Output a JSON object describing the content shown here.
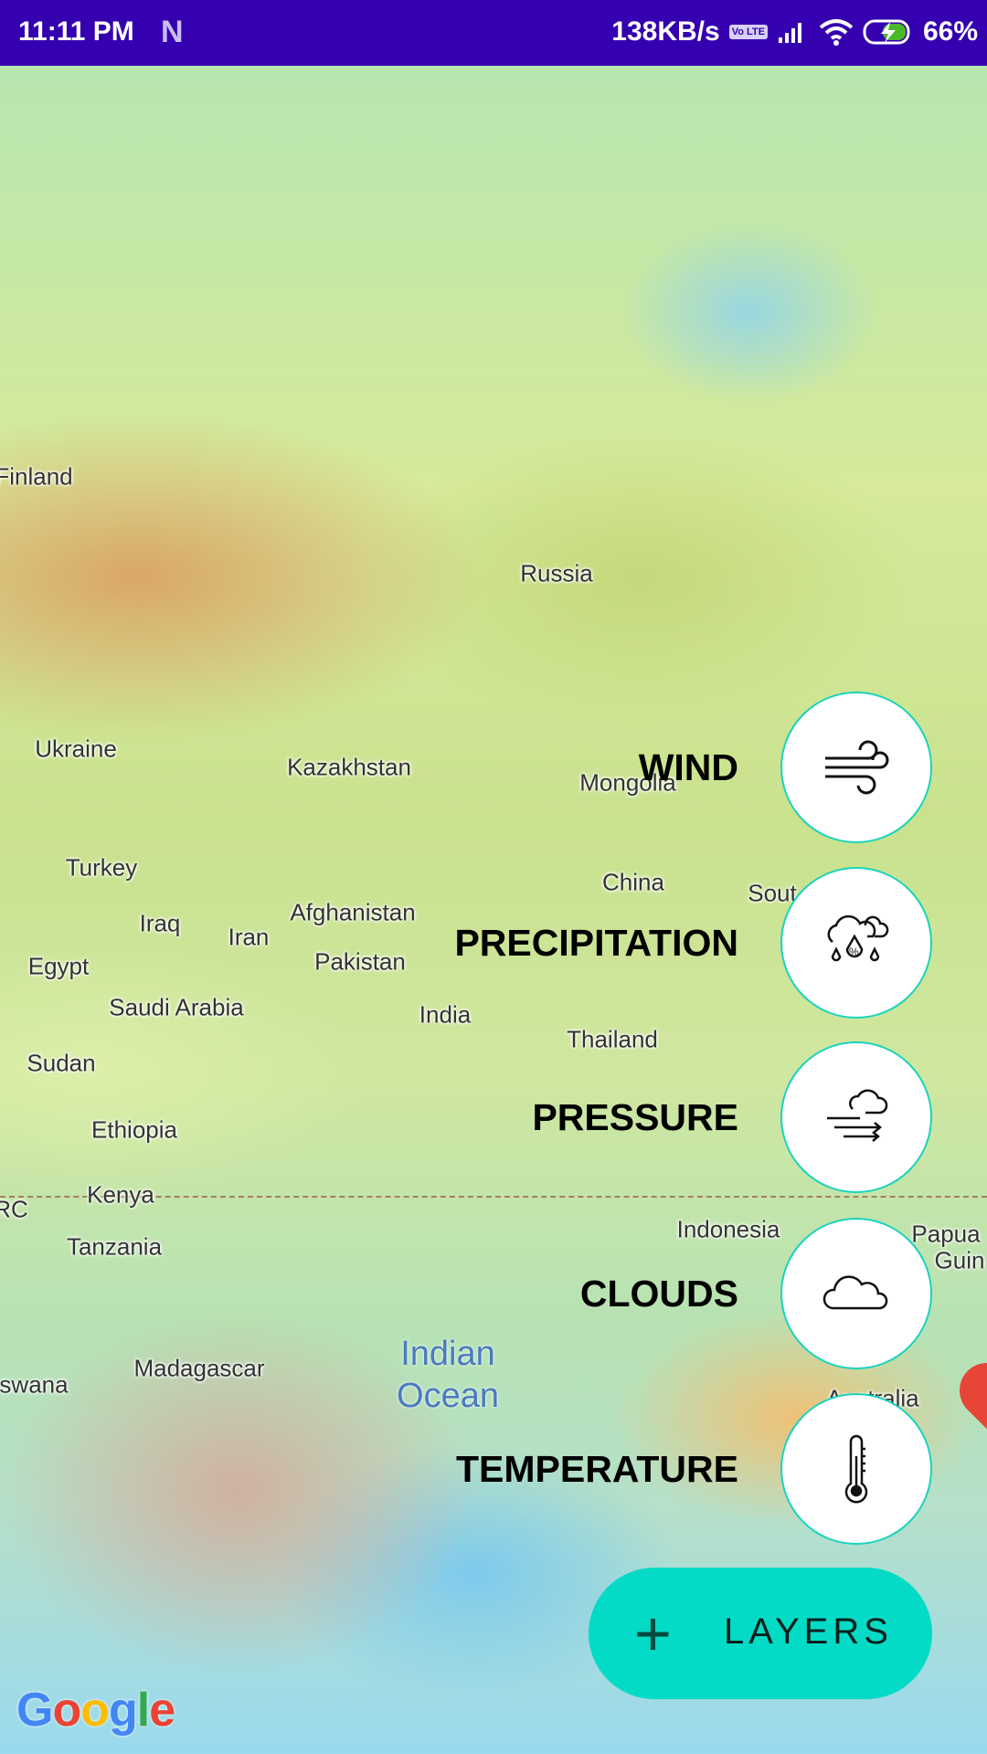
{
  "status_bar": {
    "time": "11:11 PM",
    "notification_icon": "N",
    "speed": "138KB/s",
    "volte": "Vo LTE",
    "battery": "66%"
  },
  "map": {
    "labels": [
      "Finland",
      "Russia",
      "Ukraine",
      "Kazakhstan",
      "Mongolia",
      "Turkey",
      "China",
      "Sout",
      "Iraq",
      "Iran",
      "Afghanistan",
      "Pakistan",
      "Egypt",
      "Saudi Arabia",
      "India",
      "Thailand",
      "Sudan",
      "Ethiopia",
      "Kenya",
      "RC",
      "Tanzania",
      "Indonesia",
      "Papua",
      "Guin",
      "Madagascar",
      "swana",
      "Australia"
    ],
    "ocean": [
      "Indian",
      "Ocean"
    ],
    "attribution": "Google"
  },
  "layers": [
    {
      "label": "WIND",
      "icon": "wind-icon"
    },
    {
      "label": "PRECIPITATION",
      "icon": "precipitation-icon"
    },
    {
      "label": "PRESSURE",
      "icon": "pressure-icon"
    },
    {
      "label": "CLOUDS",
      "icon": "cloud-icon"
    },
    {
      "label": "TEMPERATURE",
      "icon": "thermometer-icon"
    }
  ],
  "fab": {
    "label": "LAYERS",
    "icon": "+"
  },
  "colors": {
    "status": "#3400b0",
    "accent": "#03dbc6",
    "circle_border": "#19d3bd"
  }
}
